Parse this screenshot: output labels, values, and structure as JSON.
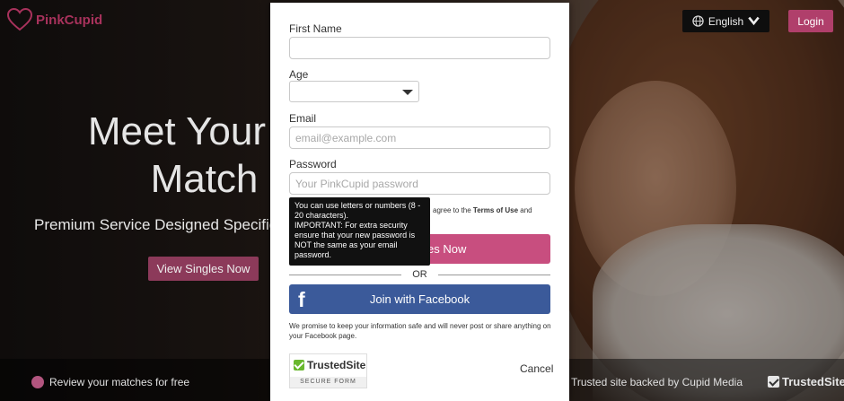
{
  "header": {
    "brand": "PinkCupid",
    "language": "English",
    "login": "Login"
  },
  "hero": {
    "title_line1": "Meet Your Le",
    "title_line2": "Match",
    "subtitle": "Premium Service Designed Specifica",
    "cta": "View Singles Now"
  },
  "footer": {
    "item1": "Review your matches for free",
    "item2": "Trusted site backed by Cupid Media",
    "trusted": "TrustedSite"
  },
  "form": {
    "first_name_label": "First Name",
    "first_name_value": "",
    "age_label": "Age",
    "age_value": "",
    "email_label": "Email",
    "email_placeholder": "email@example.com",
    "password_label": "Password",
    "password_placeholder": "Your PinkCupid password",
    "terms_prefix": "agree to the ",
    "terms_link": "Terms of Use",
    "terms_suffix": " and",
    "submit": "View Singles Now",
    "or": "OR",
    "facebook": "Join with Facebook",
    "promise": "We promise to keep your information safe and will never post or share anything on your Facebook page.",
    "trusted_badge": "TrustedSite",
    "trusted_sub": "SECURE FORM",
    "cancel": "Cancel"
  },
  "tooltip": {
    "line1": "You can use letters or numbers (8 - 20 characters).",
    "line2": "IMPORTANT: For extra security ensure that your new password is NOT the same as your email password."
  },
  "colors": {
    "brand_pink": "#c84e7f",
    "facebook_blue": "#3b5a9a",
    "trusted_green": "#69b82e"
  }
}
